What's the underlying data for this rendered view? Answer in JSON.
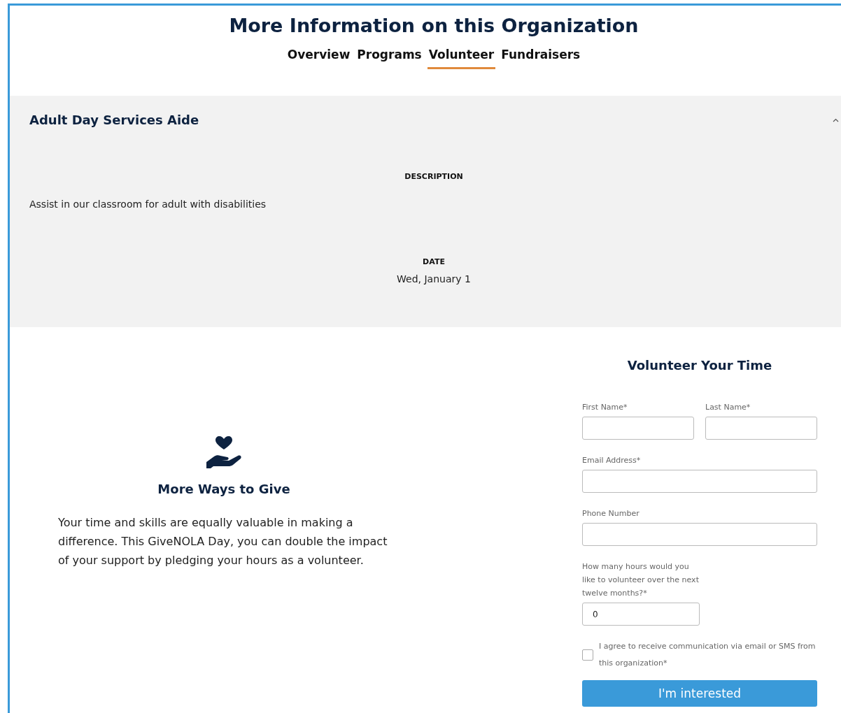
{
  "header": {
    "title": "More Information on this Organization"
  },
  "tabs": [
    {
      "label": "Overview",
      "selected": false
    },
    {
      "label": "Programs",
      "selected": false
    },
    {
      "label": "Volunteer",
      "selected": true
    },
    {
      "label": "Fundraisers",
      "selected": false
    }
  ],
  "opportunity": {
    "title": "Adult Day Services Aide",
    "expanded": true,
    "description_label": "DESCRIPTION",
    "description": "Assist in our classroom for adult with disabilities",
    "date_label": "DATE",
    "date": "Wed, January 1"
  },
  "more_ways": {
    "title": "More Ways to Give",
    "text": "Your time and skills are equally valuable in making a difference. This GiveNOLA Day, you can double the impact of your support by pledging your hours as a volunteer."
  },
  "form": {
    "title": "Volunteer Your Time",
    "fields": [
      {
        "kind": "half",
        "label": "First Name*"
      },
      {
        "kind": "half",
        "label": "Last Name*"
      },
      {
        "kind": "full",
        "label": "Email Address*"
      },
      {
        "kind": "full",
        "label": "Phone Number"
      },
      {
        "kind": "short",
        "label": "How many hours would you like to volunteer over the next twelve months?*",
        "value": "0"
      }
    ],
    "consent": {
      "label": "I agree to receive communication via email or SMS from this organization*",
      "checked": false
    },
    "button": "I'm interested"
  }
}
